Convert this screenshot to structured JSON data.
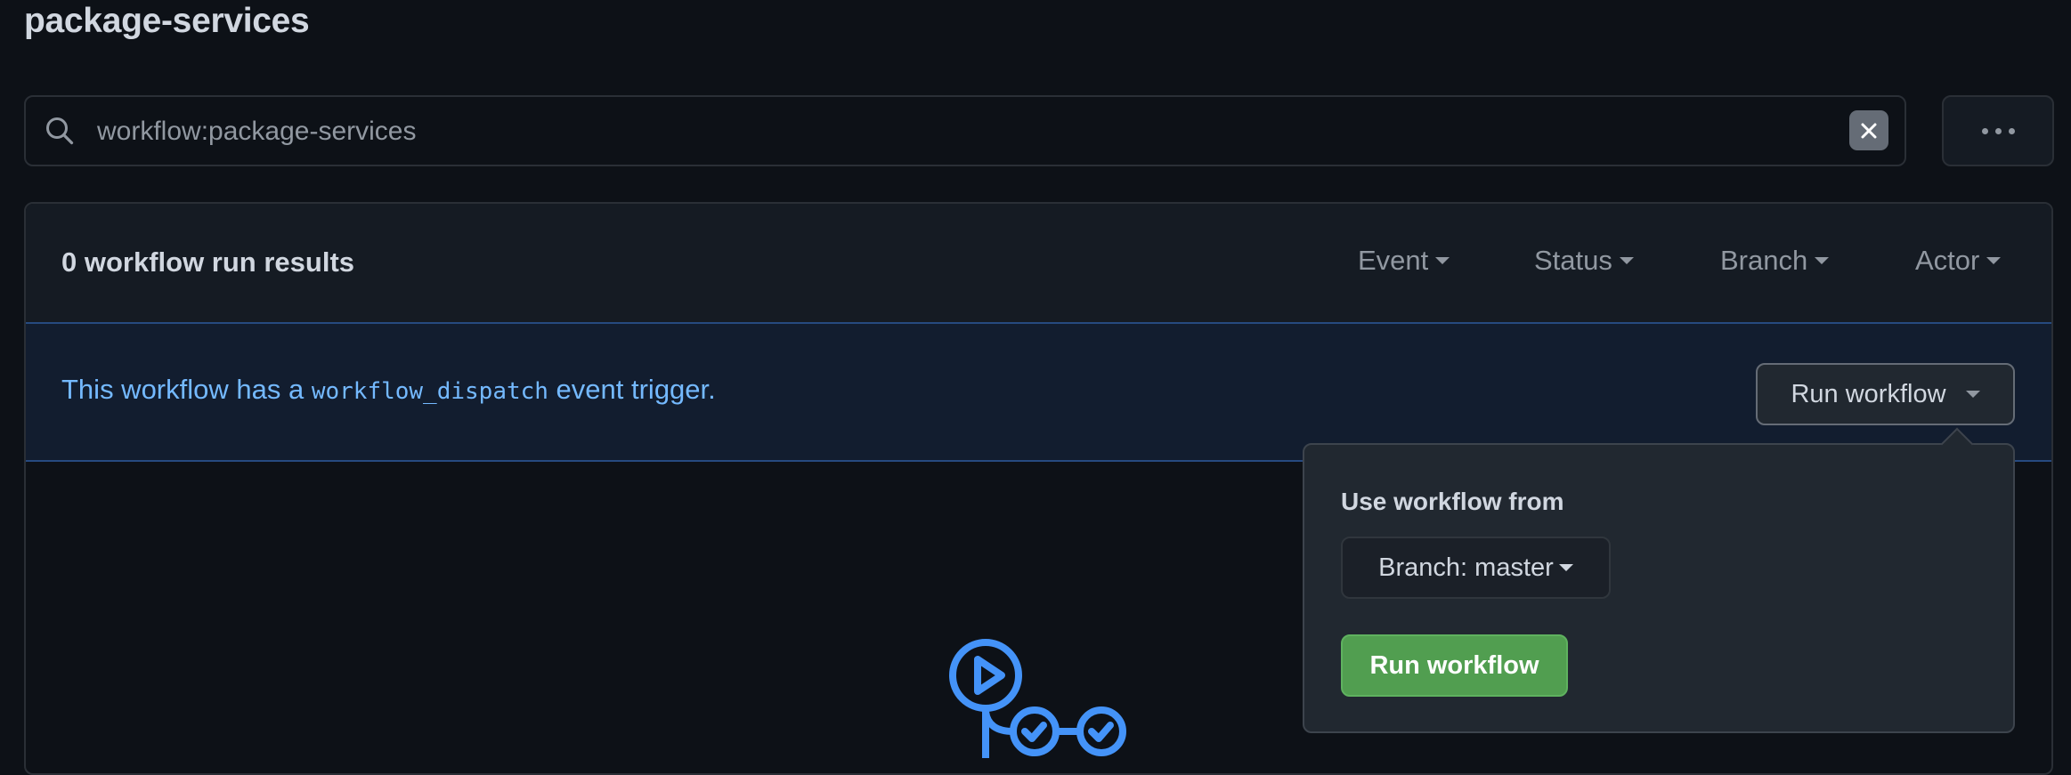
{
  "page": {
    "title": "package-services"
  },
  "search": {
    "value": "workflow:package-services",
    "clear_icon": "x-icon",
    "more_icon": "kebab-horizontal-icon"
  },
  "results": {
    "count_label": "0 workflow run results",
    "filters": [
      {
        "label": "Event"
      },
      {
        "label": "Status"
      },
      {
        "label": "Branch"
      },
      {
        "label": "Actor"
      }
    ]
  },
  "banner": {
    "text_before": "This workflow has a ",
    "code": "workflow_dispatch",
    "text_after": " event trigger.",
    "run_button_label": "Run workflow"
  },
  "popover": {
    "heading": "Use workflow from",
    "branch_label": "Branch: master",
    "submit_label": "Run workflow"
  },
  "colors": {
    "accent_blue": "#4493f8",
    "link_text": "#74b9ff",
    "primary_green": "#519e50",
    "background": "#0d1117"
  }
}
